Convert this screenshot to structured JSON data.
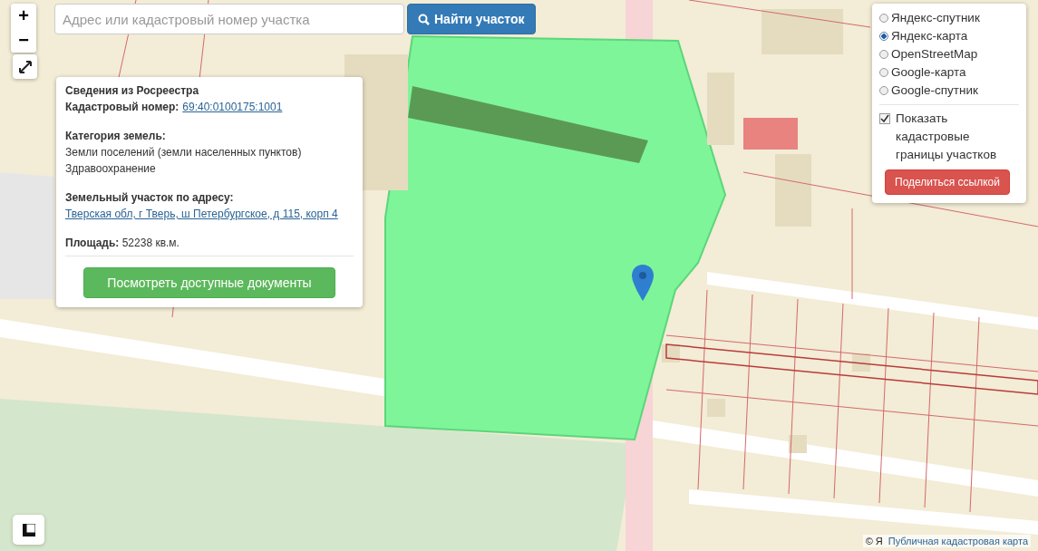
{
  "search": {
    "placeholder": "Адрес или кадастровый номер участка",
    "button": "Найти участок"
  },
  "zoom": {
    "in": "+",
    "out": "−"
  },
  "info": {
    "title": "Сведения из Росреестра",
    "cadastral_label": "Кадастровый номер:",
    "cadastral_number": "69:40:0100175:1001",
    "category_label": "Категория земель:",
    "category_lines": [
      "Земли поселений (земли населенных пунктов)",
      "Здравоохранение"
    ],
    "address_label": "Земельный участок по адресу:",
    "address": "Тверская обл, г Тверь, ш Петербургское, д 115, корп 4",
    "area": "**Площадь:** 52238 кв.м.",
    "button": "Посмотреть доступные документы"
  },
  "layers": [
    {
      "label": "Яндекс-спутник",
      "selected": false
    },
    {
      "label": "Яндекс-карта",
      "selected": true
    },
    {
      "label": "OpenStreetMap",
      "selected": false
    },
    {
      "label": "Google-карта",
      "selected": false
    },
    {
      "label": "Google-спутник",
      "selected": false
    }
  ],
  "cadastral_borders": {
    "label": "Показать кадастровые границы участков",
    "checked": true
  },
  "share_button": "Поделиться ссылкой",
  "attribution": {
    "copyright": "© Я",
    "link": "Публичная кадастровая карта"
  }
}
